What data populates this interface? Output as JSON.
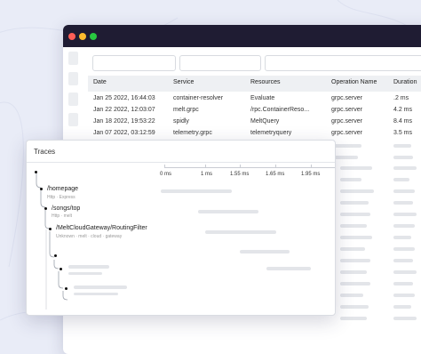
{
  "table": {
    "columns": [
      "Date",
      "Service",
      "Resources",
      "Operation Name",
      "Duration"
    ],
    "rows": [
      [
        "Jan 25 2022, 16:44:03",
        "container-resolver",
        "Evaluate",
        "grpc.server",
        ".2 ms"
      ],
      [
        "Jan 22 2022, 12:03:07",
        "melt.grpc",
        "/rpc.ContainerReso...",
        "grpc.server",
        "4.2 ms"
      ],
      [
        "Jan 18 2022, 19:53:22",
        "spidly",
        "MeltQuery",
        "grpc.server",
        "8.4 ms"
      ],
      [
        "Jan 07 2022, 03:12:59",
        "telemetry.grpc",
        "telemetryquery",
        "grpc.server",
        "3.5 ms"
      ]
    ]
  },
  "traces": {
    "title": "Traces",
    "ticks": [
      "0 ms",
      "1 ms",
      "1.55 ms",
      "1.65 ms",
      "1.95 ms"
    ],
    "spans": [
      {
        "name": "/homepage",
        "sub": "Http · Express"
      },
      {
        "name": "/songs/top",
        "sub": "Http · melt"
      },
      {
        "name": "/MeltCloudGateway/RoutingFilter",
        "sub": "Unknown · melt · cloud · gateway"
      }
    ]
  },
  "colors": {
    "titlebar": "#1f1c33",
    "background": "#e9ecf7"
  }
}
